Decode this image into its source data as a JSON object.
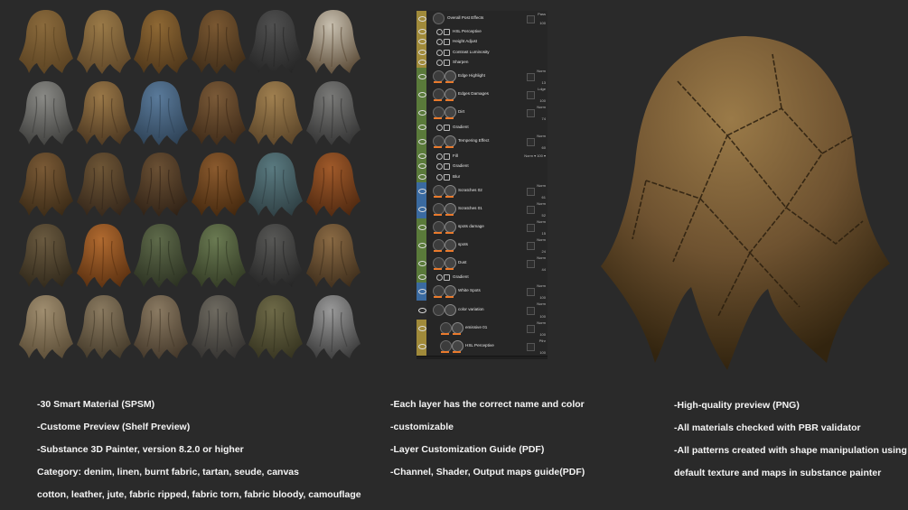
{
  "swatches": [
    {
      "c1": "#8a6a3c",
      "c2": "#5a4222"
    },
    {
      "c1": "#9a7a48",
      "c2": "#5e4628"
    },
    {
      "c1": "#8e6834",
      "c2": "#4e361a"
    },
    {
      "c1": "#7a5832",
      "c2": "#3e2c18"
    },
    {
      "c1": "#505050",
      "c2": "#262626"
    },
    {
      "c1": "#c8c0b0",
      "c2": "#5a4a36"
    },
    {
      "c1": "#8a8a86",
      "c2": "#3e3e3c"
    },
    {
      "c1": "#9a7848",
      "c2": "#4a3620"
    },
    {
      "c1": "#5a7a9a",
      "c2": "#2e4256"
    },
    {
      "c1": "#7a5a38",
      "c2": "#3e2a18"
    },
    {
      "c1": "#a08050",
      "c2": "#5a4428"
    },
    {
      "c1": "#7a7a78",
      "c2": "#343434"
    },
    {
      "c1": "#7a5a36",
      "c2": "#3a2a16"
    },
    {
      "c1": "#6e5636",
      "c2": "#34261a"
    },
    {
      "c1": "#6a5034",
      "c2": "#302216"
    },
    {
      "c1": "#8a5a2e",
      "c2": "#44280e"
    },
    {
      "c1": "#5a7a80",
      "c2": "#2e3e42"
    },
    {
      "c1": "#a05a2a",
      "c2": "#4e2810"
    },
    {
      "c1": "#6a5a40",
      "c2": "#30281a"
    },
    {
      "c1": "#b06a30",
      "c2": "#5a3010"
    },
    {
      "c1": "#5e6a4a",
      "c2": "#2c3222"
    },
    {
      "c1": "#6a7a52",
      "c2": "#323a24"
    },
    {
      "c1": "#585856",
      "c2": "#262626"
    },
    {
      "c1": "#8a6a44",
      "c2": "#3e2e1c"
    },
    {
      "c1": "#a08e70",
      "c2": "#5a4c36"
    },
    {
      "c1": "#8a7a60",
      "c2": "#443a2a"
    },
    {
      "c1": "#8a7a62",
      "c2": "#44382a"
    },
    {
      "c1": "#6e6a60",
      "c2": "#343230"
    },
    {
      "c1": "#6e6a48",
      "c2": "#363420"
    },
    {
      "c1": "#9a9a9a",
      "c2": "#3a3a3a"
    }
  ],
  "layers": [
    {
      "name": "Overall Post Effects",
      "color": "#a08a3a",
      "blend": "Pass",
      "opacity": "100",
      "style": "top"
    },
    {
      "name": "HSL Perceptive",
      "color": "#a08a3a",
      "style": "fx"
    },
    {
      "name": "Height Adjust",
      "color": "#a08a3a",
      "style": "fx"
    },
    {
      "name": "Contrast Luminosity",
      "color": "#a08a3a",
      "style": "fx"
    },
    {
      "name": "Sharpen",
      "color": "#a08a3a",
      "style": "fx"
    },
    {
      "name": "Edge Highlight",
      "color": "#5a7a3a",
      "blend": "Norm",
      "opacity": "13",
      "style": "fill"
    },
    {
      "name": "Edges Damages",
      "color": "#5a7a3a",
      "blend": "Ldge",
      "opacity": "100",
      "style": "fill"
    },
    {
      "name": "Dirt",
      "color": "#5a7a3a",
      "blend": "Norm",
      "opacity": "74",
      "style": "fill"
    },
    {
      "name": "Gradient",
      "color": "#5a7a3a",
      "style": "fx"
    },
    {
      "name": "Tempering Effect",
      "color": "#5a7a3a",
      "blend": "Norm",
      "opacity": "60",
      "style": "fill"
    },
    {
      "name": "Fill",
      "color": "#5a7a3a",
      "blend": "Norm",
      "opacity": "100",
      "style": "fxb"
    },
    {
      "name": "Gradient",
      "color": "#5a7a3a",
      "style": "fx"
    },
    {
      "name": "Blur",
      "color": "#5a7a3a",
      "style": "fx"
    },
    {
      "name": "Scratches 02",
      "color": "#3a6aa0",
      "blend": "Norm",
      "opacity": "61",
      "style": "fill"
    },
    {
      "name": "Scratches 01",
      "color": "#3a6aa0",
      "blend": "Norm",
      "opacity": "52",
      "style": "fill"
    },
    {
      "name": "spots damage",
      "color": "#5a7a3a",
      "blend": "Norm",
      "opacity": "15",
      "style": "fill"
    },
    {
      "name": "spots",
      "color": "#5a7a3a",
      "blend": "Norm",
      "opacity": "24",
      "style": "fill"
    },
    {
      "name": "Dust",
      "color": "#5a7a3a",
      "blend": "Norm",
      "opacity": "44",
      "style": "fill"
    },
    {
      "name": "Gradient",
      "color": "#5a7a3a",
      "style": "fx"
    },
    {
      "name": "White Spots",
      "color": "#3a6aa0",
      "blend": "Norm",
      "opacity": "100",
      "style": "fill"
    },
    {
      "name": "color variation",
      "color": "#2a2a2a",
      "blend": "Norm",
      "opacity": "100",
      "style": "folder"
    },
    {
      "name": "emissive 01",
      "color": "#a08a3a",
      "blend": "Norm",
      "opacity": "100",
      "style": "sub"
    },
    {
      "name": "HSL Perceptive",
      "color": "#a08a3a",
      "blend": "Pthr",
      "opacity": "100",
      "style": "sub"
    }
  ],
  "col1": {
    "l1": "-30 Smart Material  (SPSM)",
    "l2": "-Custome Preview (Shelf Preview)",
    "l3": "-Substance 3D Painter, version 8.2.0 or higher",
    "l4": "Category: denim, linen, burnt fabric, tartan, seude, canvas",
    "l5": "cotton, leather, jute, fabric ripped, fabric torn, fabric bloody, camouflage"
  },
  "col2": {
    "l1": "-Each layer has the correct name and color",
    "l2": "-customizable",
    "l3": "-Layer Customization Guide (PDF)",
    "l4": "-Channel, Shader, Output maps guide(PDF)"
  },
  "col3": {
    "l1": "-High-quality preview (PNG)",
    "l2": "-All materials checked with PBR validator",
    "l3": "-All patterns created with shape manipulation using",
    "l4": "default texture and maps in substance painter"
  },
  "colors": {
    "background": "#2a2a2a",
    "accent": "#ea7a2c",
    "big_cloth_light": "#8a6a3c",
    "big_cloth_dark": "#3e2c16"
  }
}
